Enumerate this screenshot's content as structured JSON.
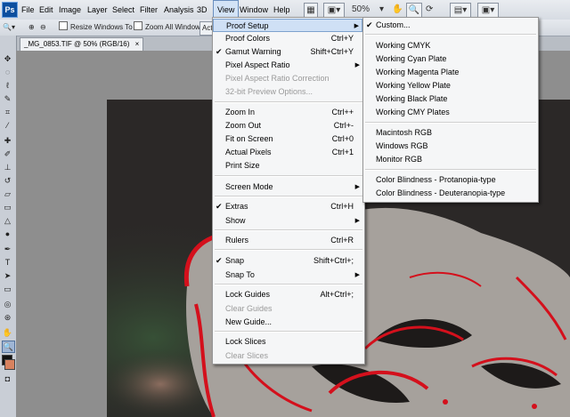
{
  "app": {
    "logo": "Ps"
  },
  "menubar": {
    "items": [
      "File",
      "Edit",
      "Image",
      "Layer",
      "Select",
      "Filter",
      "Analysis",
      "3D",
      "View",
      "Window",
      "Help"
    ],
    "zoom_display": "50%"
  },
  "options_bar": {
    "resize_windows": "Resize Windows To Fit",
    "zoom_all_windows": "Zoom All Windows",
    "actual_pixels_button": "Act"
  },
  "document": {
    "tab_title": "_MG_0853.TIF @ 50% (RGB/16)",
    "close_glyph": "×"
  },
  "view_menu": {
    "items": [
      {
        "label": "Proof Setup",
        "shortcut": "",
        "submenu": true,
        "highlighted": true
      },
      {
        "label": "Proof Colors",
        "shortcut": "Ctrl+Y"
      },
      {
        "label": "Gamut Warning",
        "shortcut": "Shift+Ctrl+Y",
        "checked": true
      },
      {
        "label": "Pixel Aspect Ratio",
        "shortcut": "",
        "submenu": true
      },
      {
        "label": "Pixel Aspect Ratio Correction",
        "shortcut": "",
        "disabled": true
      },
      {
        "label": "32-bit Preview Options...",
        "shortcut": "",
        "disabled": true
      },
      {
        "label": "Zoom In",
        "shortcut": "Ctrl++"
      },
      {
        "label": "Zoom Out",
        "shortcut": "Ctrl+-"
      },
      {
        "label": "Fit on Screen",
        "shortcut": "Ctrl+0"
      },
      {
        "label": "Actual Pixels",
        "shortcut": "Ctrl+1"
      },
      {
        "label": "Print Size",
        "shortcut": ""
      },
      {
        "label": "Screen Mode",
        "shortcut": "",
        "submenu": true
      },
      {
        "label": "Extras",
        "shortcut": "Ctrl+H",
        "checked": true
      },
      {
        "label": "Show",
        "shortcut": "",
        "submenu": true
      },
      {
        "label": "Rulers",
        "shortcut": "Ctrl+R"
      },
      {
        "label": "Snap",
        "shortcut": "Shift+Ctrl+;",
        "checked": true
      },
      {
        "label": "Snap To",
        "shortcut": "",
        "submenu": true
      },
      {
        "label": "Lock Guides",
        "shortcut": "Alt+Ctrl+;"
      },
      {
        "label": "Clear Guides",
        "shortcut": "",
        "disabled": true
      },
      {
        "label": "New Guide...",
        "shortcut": ""
      },
      {
        "label": "Lock Slices",
        "shortcut": ""
      },
      {
        "label": "Clear Slices",
        "shortcut": "",
        "disabled": true
      }
    ]
  },
  "proof_submenu": {
    "items": [
      {
        "label": "Custom...",
        "checked": true
      },
      {
        "label": "Working CMYK"
      },
      {
        "label": "Working Cyan Plate"
      },
      {
        "label": "Working Magenta Plate"
      },
      {
        "label": "Working Yellow Plate"
      },
      {
        "label": "Working Black Plate"
      },
      {
        "label": "Working CMY Plates"
      },
      {
        "label": "Macintosh RGB"
      },
      {
        "label": "Windows RGB"
      },
      {
        "label": "Monitor RGB"
      },
      {
        "label": "Color Blindness - Protanopia-type"
      },
      {
        "label": "Color Blindness - Deuteranopia-type"
      }
    ]
  },
  "glyphs": {
    "check": "✔",
    "arrow": "▶"
  },
  "colors": {
    "gamut_warning": "#d4101c",
    "rose_gray": "#a6a19c",
    "photo_bg": "#2b2827"
  }
}
